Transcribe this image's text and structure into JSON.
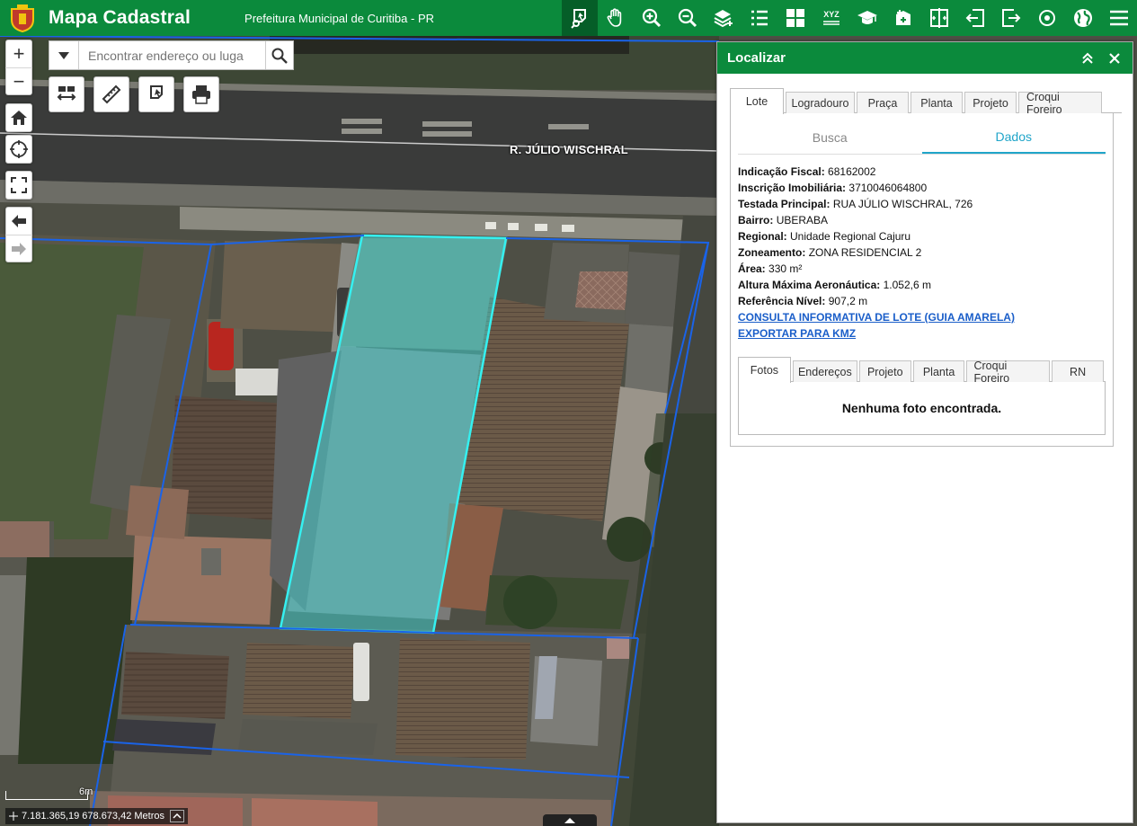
{
  "header": {
    "app_title": "Mapa Cadastral",
    "subtitle": "Prefeitura Municipal de Curitiba - PR",
    "toolbar": [
      {
        "icon": "identify-icon",
        "active": true
      },
      {
        "icon": "pan-hand-icon"
      },
      {
        "icon": "zoom-in-icon"
      },
      {
        "icon": "zoom-out-icon"
      },
      {
        "icon": "add-layer-icon"
      },
      {
        "icon": "layer-list-icon"
      },
      {
        "icon": "basemap-grid-icon"
      },
      {
        "icon": "xyz-coordinates-icon"
      },
      {
        "icon": "graduation-cap-icon"
      },
      {
        "icon": "add-data-icon"
      },
      {
        "icon": "swipe-icon"
      },
      {
        "icon": "import-icon"
      },
      {
        "icon": "export-icon"
      },
      {
        "icon": "locate-icon"
      },
      {
        "icon": "globe-icon"
      },
      {
        "icon": "menu-icon"
      }
    ],
    "toolbar_xyz_text": "XYZ"
  },
  "map": {
    "search_placeholder": "Encontrar endereço ou luga",
    "street_label": "R. JÚLIO WISCHRAL",
    "scale_label": "6m",
    "coordinates": "7.181.365,19 678.673,42 Metros"
  },
  "panel": {
    "title": "Localizar",
    "tabs": [
      "Lote",
      "Logradouro",
      "Praça",
      "Planta",
      "Projeto",
      "Croqui Foreiro"
    ],
    "active_tab": "Lote",
    "subtabs": [
      "Busca",
      "Dados"
    ],
    "active_subtab": "Dados",
    "info": [
      {
        "label": "Indicação Fiscal:",
        "value": "68162002"
      },
      {
        "label": "Inscrição Imobiliária:",
        "value": "3710046064800"
      },
      {
        "label": "Testada Principal:",
        "value": "RUA JÚLIO WISCHRAL, 726"
      },
      {
        "label": "Bairro:",
        "value": "UBERABA"
      },
      {
        "label": "Regional:",
        "value": "Unidade Regional Cajuru"
      },
      {
        "label": "Zoneamento:",
        "value": "ZONA RESIDENCIAL 2"
      },
      {
        "label": "Área:",
        "value": "330 m²"
      },
      {
        "label": "Altura Máxima Aeronáutica:",
        "value": "1.052,6 m"
      },
      {
        "label": "Referência Nível:",
        "value": "907,2 m"
      }
    ],
    "links": [
      "CONSULTA INFORMATIVA DE LOTE (GUIA AMARELA)",
      "EXPORTAR PARA KMZ"
    ],
    "photo_tabs": [
      "Fotos",
      "Endereços",
      "Projeto",
      "Planta",
      "Croqui Foreiro",
      "RN"
    ],
    "active_photo_tab": "Fotos",
    "no_photo_message": "Nenhuma foto encontrada."
  }
}
